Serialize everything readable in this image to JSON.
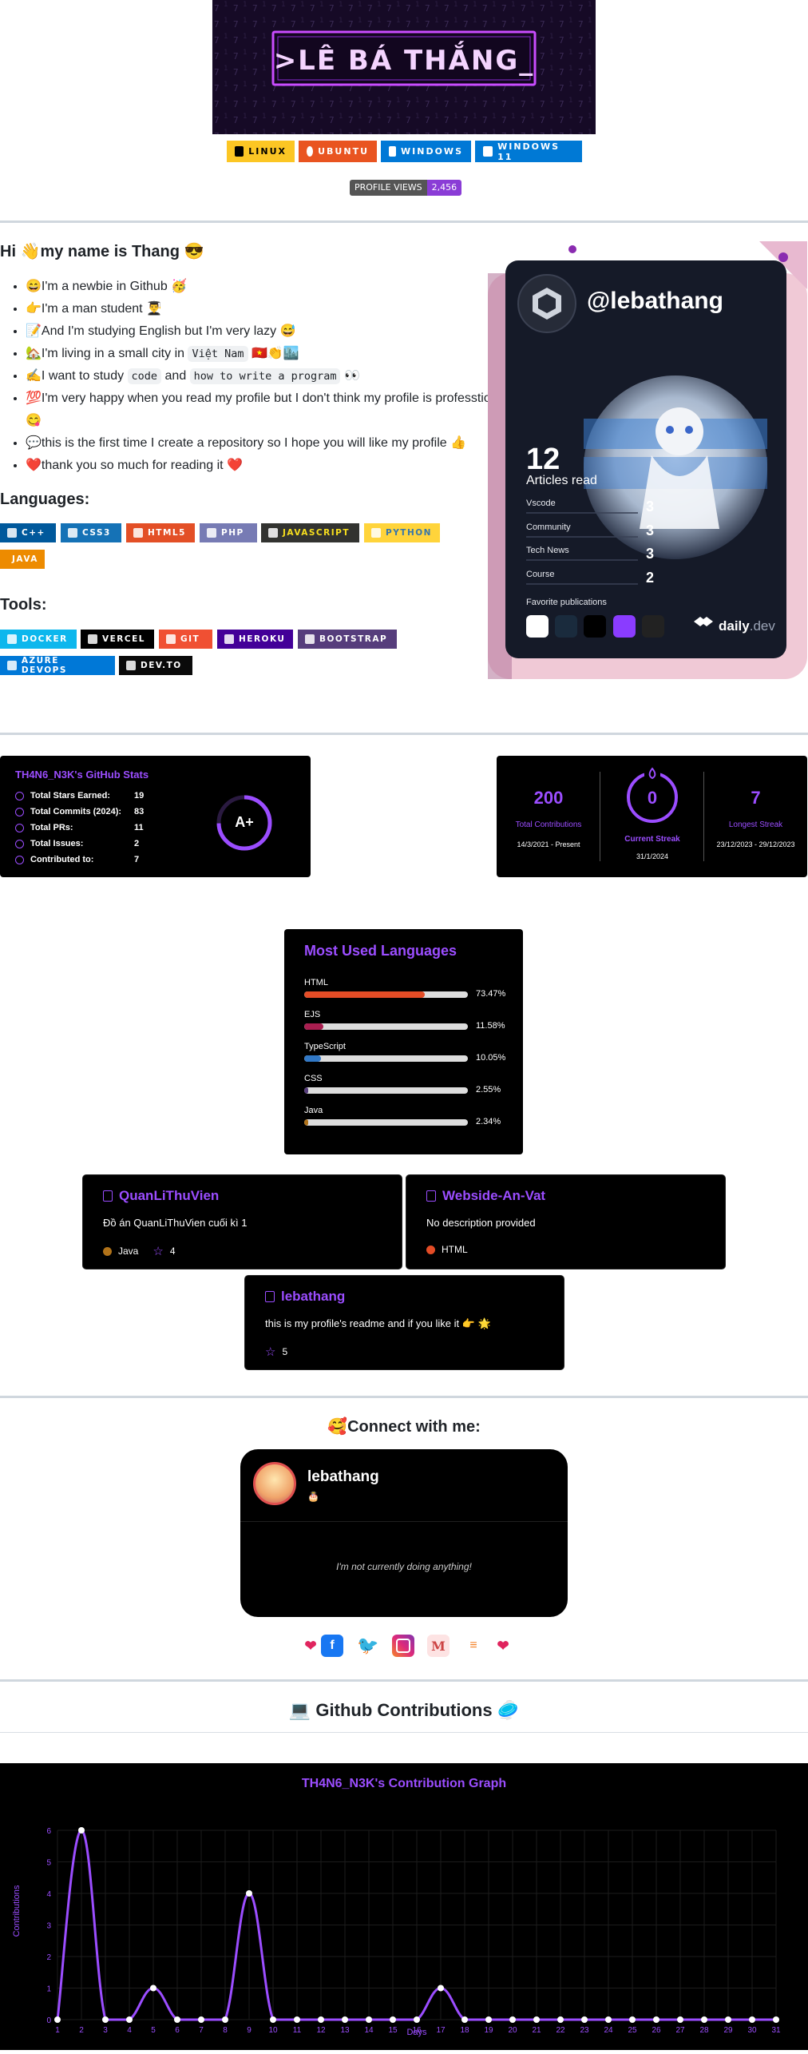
{
  "banner": {
    "text": ">LÊ BÁ THẮNG_"
  },
  "os_badges": [
    {
      "label": "LINUX",
      "bg": "#FCC624",
      "fg": "#000000",
      "icon": "tux-icon"
    },
    {
      "label": "UBUNTU",
      "bg": "#E95420",
      "fg": "#ffffff",
      "icon": "ubuntu-icon"
    },
    {
      "label": "WINDOWS",
      "bg": "#0078D6",
      "fg": "#ffffff",
      "icon": "windows-icon"
    },
    {
      "label": "WINDOWS 11",
      "bg": "#0079D5",
      "fg": "#ffffff",
      "icon": "windows-icon"
    }
  ],
  "profile_views": {
    "label": "PROFILE VIEWS",
    "count": "2,456"
  },
  "intro": {
    "heading": "Hi 👋my name is Thang 😎",
    "items": [
      "😄I'm a newbie in Github 🥳",
      "👉I'm a man student 👨‍🎓",
      "📝And I'm studying English but I'm very lazy 😅",
      "🏡I'm living in a small city in",
      "✍️I want to study",
      "💯I'm very happy when you read my profile but I don't think my profile is professtion 😋",
      "💬this is the first time I create a repository so I hope you will like my profile 👍",
      "❤️thank you so much for reading it ❤️"
    ],
    "item4_code": "Việt Nam",
    "item4_tail": "🇻🇳👏🏙️",
    "item5_code1": "code",
    "item5_and": "and",
    "item5_code2": "how to write a program",
    "item5_tail": "👀"
  },
  "languages": {
    "heading": "Languages:",
    "badges": [
      {
        "label": "C++",
        "bg": "#00599C",
        "fg": "#ffffff"
      },
      {
        "label": "CSS3",
        "bg": "#1572B6",
        "fg": "#ffffff"
      },
      {
        "label": "HTML5",
        "bg": "#E34F26",
        "fg": "#ffffff"
      },
      {
        "label": "PHP",
        "bg": "#777BB4",
        "fg": "#ffffff"
      },
      {
        "label": "JAVASCRIPT",
        "bg": "#323330",
        "fg": "#F7DF1E"
      },
      {
        "label": "PYTHON",
        "bg": "#FFD43B",
        "fg": "#3776AB"
      },
      {
        "label": "JAVA",
        "bg": "#ED8B00",
        "fg": "#ffffff"
      }
    ]
  },
  "tools": {
    "heading": "Tools:",
    "badges": [
      {
        "label": "DOCKER",
        "bg": "#0db7ed",
        "fg": "#ffffff"
      },
      {
        "label": "VERCEL",
        "bg": "#000000",
        "fg": "#ffffff"
      },
      {
        "label": "GIT",
        "bg": "#F05033",
        "fg": "#ffffff"
      },
      {
        "label": "HEROKU",
        "bg": "#430098",
        "fg": "#ffffff"
      },
      {
        "label": "BOOTSTRAP",
        "bg": "#563D7C",
        "fg": "#ffffff"
      },
      {
        "label": "AZURE DEVOPS",
        "bg": "#0078D7",
        "fg": "#ffffff"
      },
      {
        "label": "DEV.TO",
        "bg": "#0A0A0A",
        "fg": "#ffffff"
      }
    ]
  },
  "daily_dev": {
    "handle": "@lebathang",
    "articles_count": "12",
    "articles_label": "Articles read",
    "stats": [
      {
        "label": "Vscode",
        "value": "3"
      },
      {
        "label": "Community",
        "value": "3"
      },
      {
        "label": "Tech News",
        "value": "3"
      },
      {
        "label": "Course",
        "value": "2"
      }
    ],
    "favorite_label": "Favorite publications",
    "logo": "daily",
    "logo_suffix": ".dev"
  },
  "github_stats": {
    "title": "TH4N6_N3K's GitHub Stats",
    "rows": [
      {
        "label": "Total Stars Earned:",
        "value": "19",
        "icon": "star-icon"
      },
      {
        "label": "Total Commits (2024):",
        "value": "83",
        "icon": "clock-icon"
      },
      {
        "label": "Total PRs:",
        "value": "11",
        "icon": "pull-request-icon"
      },
      {
        "label": "Total Issues:",
        "value": "2",
        "icon": "issue-icon"
      },
      {
        "label": "Contributed to:",
        "value": "7",
        "icon": "repo-icon"
      }
    ],
    "grade": "A+"
  },
  "streak": {
    "total": {
      "value": "200",
      "label": "Total Contributions",
      "range": "14/3/2021 - Present"
    },
    "current": {
      "value": "0",
      "label": "Current Streak",
      "range": "31/1/2024"
    },
    "longest": {
      "value": "7",
      "label": "Longest Streak",
      "range": "23/12/2023 - 29/12/2023"
    }
  },
  "top_langs": {
    "title": "Most Used Languages",
    "items": [
      {
        "name": "HTML",
        "percent": 73.47,
        "label": "73.47%",
        "color": "#e34c26"
      },
      {
        "name": "EJS",
        "percent": 11.58,
        "label": "11.58%",
        "color": "#a91e50"
      },
      {
        "name": "TypeScript",
        "percent": 10.05,
        "label": "10.05%",
        "color": "#3178c6"
      },
      {
        "name": "CSS",
        "percent": 2.55,
        "label": "2.55%",
        "color": "#563d7c"
      },
      {
        "name": "Java",
        "percent": 2.34,
        "label": "2.34%",
        "color": "#b07219"
      }
    ]
  },
  "repos": [
    {
      "name": "QuanLiThuVien",
      "desc": "Đồ án QuanLiThuVien cuối kì 1",
      "lang": "Java",
      "lang_color": "#b07219",
      "stars": "4"
    },
    {
      "name": "Webside-An-Vat",
      "desc": "No description provided",
      "lang": "HTML",
      "lang_color": "#e34c26",
      "stars": ""
    },
    {
      "name": "lebathang",
      "desc": "this is my profile's readme and if you like it 👉 🌟",
      "lang": "",
      "lang_color": "",
      "stars": "5"
    }
  ],
  "connect": {
    "heading": "🥰Connect with me:",
    "discord_name": "lebathang",
    "discord_status": "🎂",
    "discord_activity": "I'm not currently doing anything!",
    "socials": [
      "heart-icon",
      "facebook-icon",
      "twitter-icon",
      "instagram-icon",
      "medium-icon",
      "stackoverflow-icon",
      "heart-icon"
    ]
  },
  "contributions": {
    "heading": "💻 Github Contributions 🥏"
  },
  "chart_data": {
    "type": "line",
    "title": "TH4N6_N3K's Contribution Graph",
    "xlabel": "Days",
    "ylabel": "Contributions",
    "x": [
      1,
      2,
      3,
      4,
      5,
      6,
      7,
      8,
      9,
      10,
      11,
      12,
      13,
      14,
      15,
      16,
      17,
      18,
      19,
      20,
      21,
      22,
      23,
      24,
      25,
      26,
      27,
      28,
      29,
      30,
      31
    ],
    "values": [
      0,
      6,
      0,
      0,
      1,
      0,
      0,
      0,
      4,
      0,
      0,
      0,
      0,
      0,
      0,
      0,
      1,
      0,
      0,
      0,
      0,
      0,
      0,
      0,
      0,
      0,
      0,
      0,
      0,
      0,
      0
    ],
    "ylim": [
      0,
      6
    ],
    "grid": true,
    "line_color": "#9b4dff",
    "bg": "#000000"
  }
}
